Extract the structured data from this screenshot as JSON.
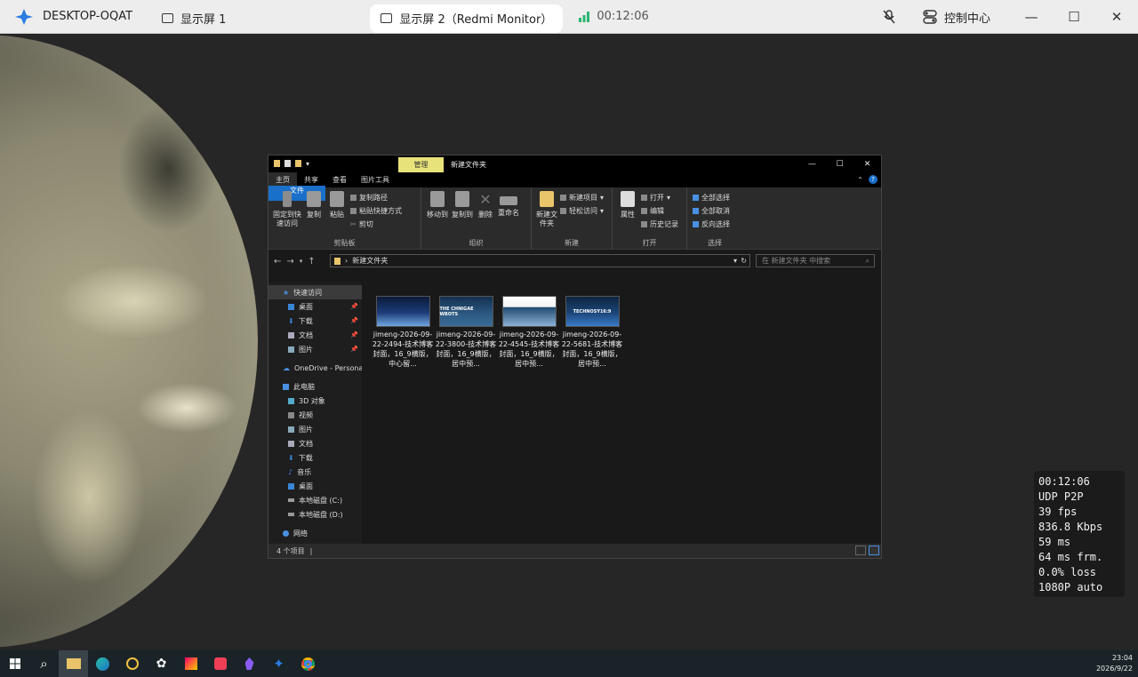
{
  "topbar": {
    "host_name": "DESKTOP-OQAT",
    "tab1_label": "显示屏 1",
    "tab2_label": "显示屏 2（Redmi Monitor）",
    "session_time": "00:12:06",
    "control_center_label": "控制中心"
  },
  "stats_overlay": {
    "lines": [
      "00:12:06",
      "UDP P2P",
      "39 fps",
      "836.8 Kbps",
      "59 ms",
      "64 ms frm.",
      "0.0% loss",
      "1080P auto"
    ]
  },
  "explorer": {
    "manage_tab": "管理",
    "folder_name": "新建文件夹",
    "ribbon_tabs": [
      "文件",
      "主页",
      "共享",
      "查看",
      "图片工具"
    ],
    "clipboard": {
      "pin_label": "固定到快速访问",
      "copy_label": "复制",
      "paste_label": "粘贴",
      "copy_path": "复制路径",
      "paste_shortcut": "粘贴快捷方式",
      "cut": "剪切",
      "group_label": "剪贴板"
    },
    "organize": {
      "move_to": "移动到",
      "copy_to": "复制到",
      "delete": "删除",
      "rename": "重命名",
      "group_label": "组织"
    },
    "new_group": {
      "new_folder": "新建文件夹",
      "new_item": "新建项目",
      "easy_access": "轻松访问",
      "group_label": "新建"
    },
    "open_group": {
      "properties": "属性",
      "open": "打开",
      "edit": "编辑",
      "history": "历史记录",
      "group_label": "打开"
    },
    "select_group": {
      "select_all": "全部选择",
      "select_none": "全部取消",
      "invert": "反向选择",
      "group_label": "选择"
    },
    "address_path": "新建文件夹",
    "search_placeholder": "在 新建文件夹 中搜索",
    "nav": {
      "quick_access": "快速访问",
      "qa_items": [
        "桌面",
        "下载",
        "文档",
        "图片"
      ],
      "onedrive": "OneDrive - Personal",
      "this_pc": "此电脑",
      "pc_items": [
        "3D 对象",
        "视频",
        "图片",
        "文档",
        "下载",
        "音乐",
        "桌面",
        "本地磁盘 (C:)",
        "本地磁盘 (D:)"
      ],
      "network": "网络"
    },
    "files": [
      {
        "name": "jimeng-2026-09-22-2494-技术博客封面，16_9横版，中心留...",
        "thumb_text": ""
      },
      {
        "name": "jimeng-2026-09-22-3800-技术博客封面，16_9横版，居中预...",
        "thumb_text": "THE CHNIGAE WBOTS"
      },
      {
        "name": "jimeng-2026-09-22-4545-技术博客封面，16_9横版，居中预...",
        "thumb_text": ""
      },
      {
        "name": "jimeng-2026-09-22-5681-技术博客封面，16_9横版，居中预...",
        "thumb_text": "TECHNOSY16:9"
      }
    ],
    "status_count": "4 个项目"
  },
  "taskbar": {
    "time": "23:04",
    "date": "2026/9/22"
  },
  "colors": {
    "accent": "#1a6fc9",
    "manage_tab": "#e8e27a",
    "signal": "#2bb673"
  }
}
